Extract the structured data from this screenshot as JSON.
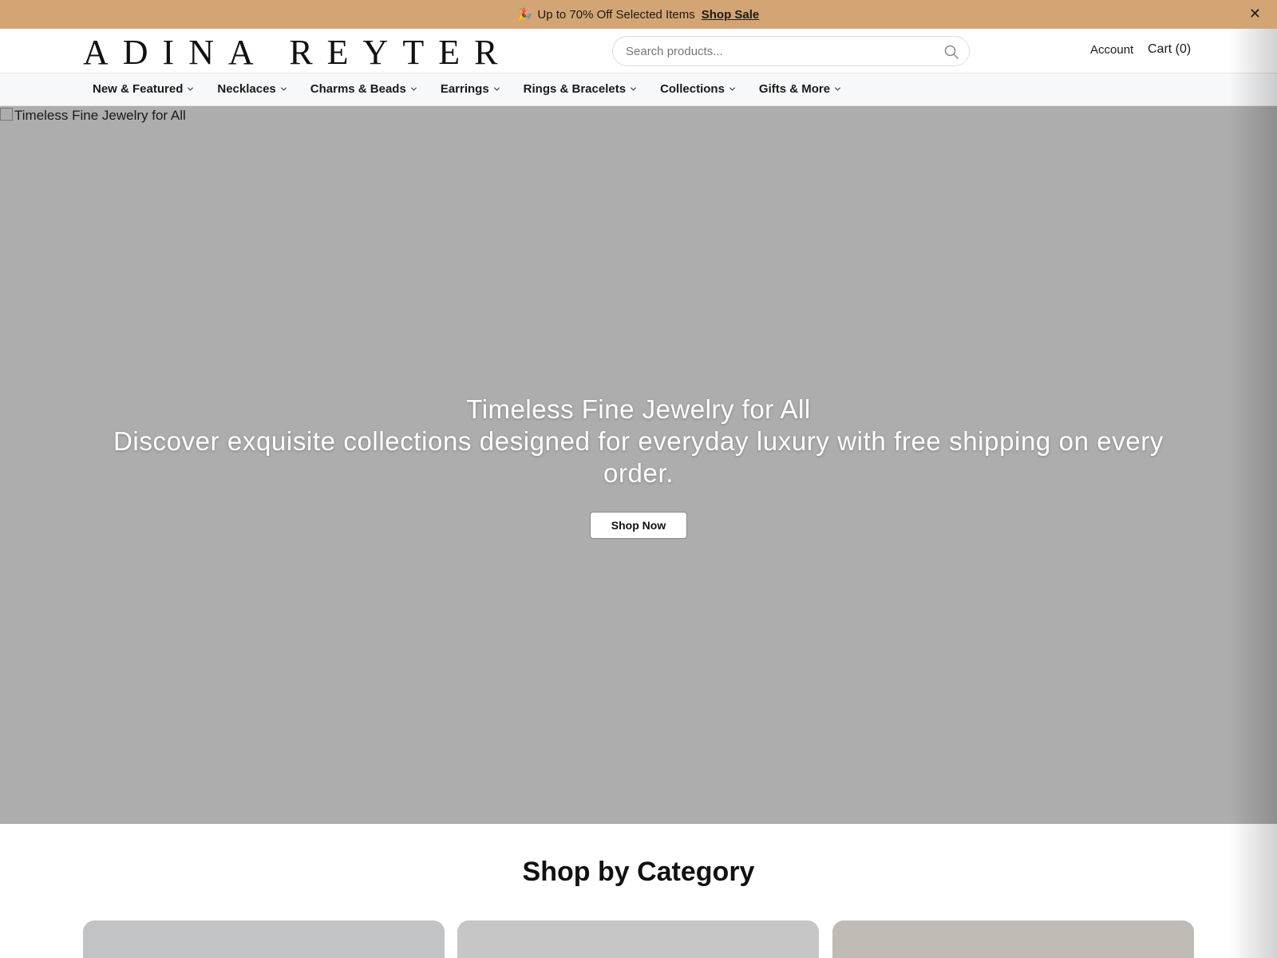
{
  "promo": {
    "emoji": "🎉",
    "text": "Up to 70% Off Selected Items",
    "link_label": "Shop Sale",
    "close_label": "✕"
  },
  "header": {
    "logo": "ADINA REYTER",
    "search": {
      "placeholder": "Search products..."
    },
    "account_label": "Account",
    "cart_label": "Cart (0)"
  },
  "nav": {
    "items": [
      {
        "label": "New & Featured"
      },
      {
        "label": "Necklaces"
      },
      {
        "label": "Charms & Beads"
      },
      {
        "label": "Earrings"
      },
      {
        "label": "Rings & Bracelets"
      },
      {
        "label": "Collections"
      },
      {
        "label": "Gifts & More"
      }
    ]
  },
  "hero": {
    "image_alt": "Timeless Fine Jewelry for All",
    "title": "Timeless Fine Jewelry for All",
    "subtitle": "Discover exquisite collections designed for everyday luxury with free shipping on every order.",
    "cta_label": "Shop Now"
  },
  "categories": {
    "title": "Shop by Category"
  },
  "colors": {
    "promo_bg": "#d4a574",
    "hero_bg": "#adadad",
    "nav_bg": "#f7f8f9"
  }
}
